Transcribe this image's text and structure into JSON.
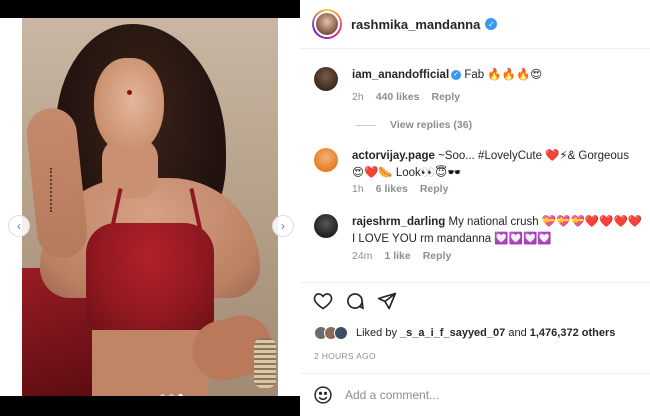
{
  "post": {
    "username": "rashmika_mandanna",
    "carousel_dots": 3,
    "carousel_active_index": 2
  },
  "comments": [
    {
      "username": "iam_anandofficial",
      "verified": true,
      "text": "Fab 🔥🔥🔥😍",
      "time": "2h",
      "likes": "440 likes",
      "reply": "Reply",
      "view_replies": "View replies (36)"
    },
    {
      "username": "actorvijay.page",
      "verified": false,
      "text": "~Soo... #LovelyCute ❤️⚡& Gorgeous 😍❤️🌭 Look👀😇🕶️",
      "time": "1h",
      "likes": "6 likes",
      "reply": "Reply"
    },
    {
      "username": "rajeshrm_darling",
      "verified": false,
      "text": "My national crush 💝💝💝❤️❤️❤️❤️ I LOVE YOU rm mandanna 💟💟💟💟",
      "time": "24m",
      "likes": "1 like",
      "reply": "Reply"
    }
  ],
  "likes": {
    "prefix": "Liked by",
    "user": "_s_a_i_f_sayyed_07",
    "joiner": "and",
    "others": "1,476,372 others"
  },
  "timestamp": "2 HOURS AGO",
  "comment_input": {
    "placeholder": "Add a comment..."
  },
  "colors": {
    "verified": "#3897f0",
    "text": "#262626",
    "muted": "#8e8e8e"
  }
}
